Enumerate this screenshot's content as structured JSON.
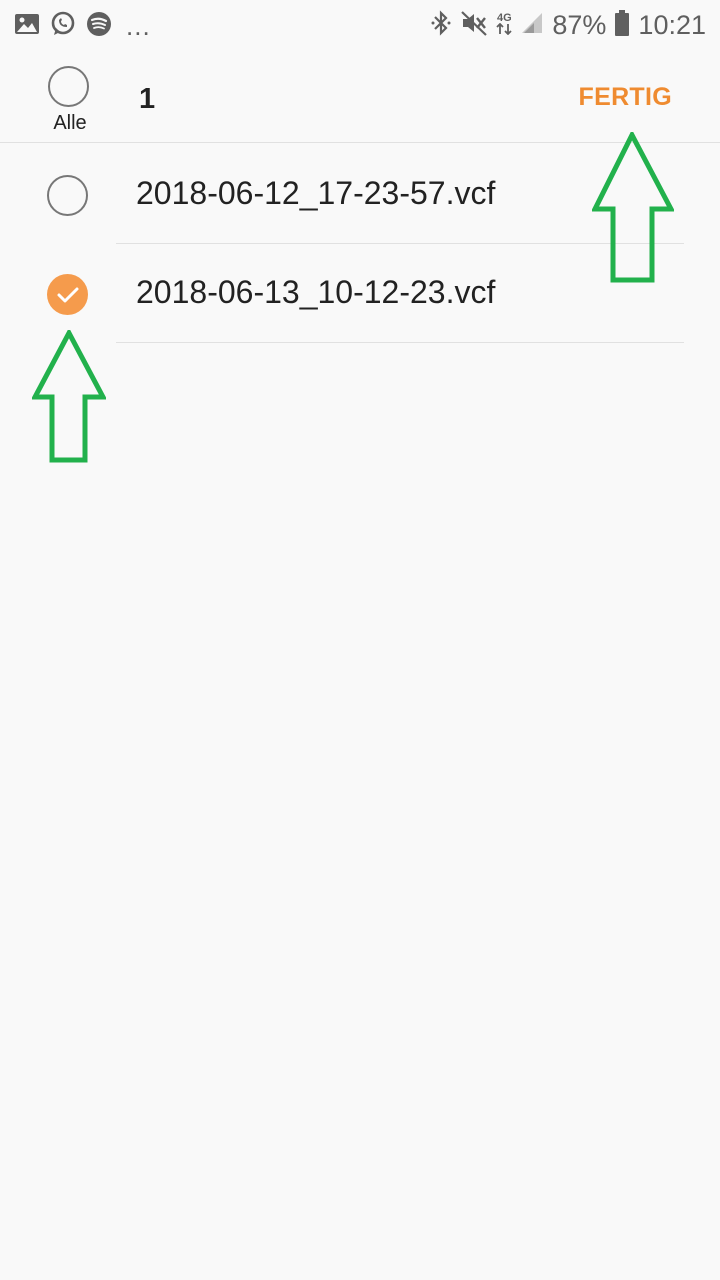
{
  "status_bar": {
    "left_icons": [
      "gallery-icon",
      "whatsapp-icon",
      "spotify-icon"
    ],
    "overflow": "...",
    "network": "4G",
    "battery_percent": "87%",
    "time": "10:21"
  },
  "header": {
    "select_all_label": "Alle",
    "selected_count": "1",
    "done_label": "FERTIG"
  },
  "files": [
    {
      "name": "2018-06-12_17-23-57.vcf",
      "checked": false
    },
    {
      "name": "2018-06-13_10-12-23.vcf",
      "checked": true
    }
  ],
  "colors": {
    "accent": "#ef8b30",
    "check_fill": "#f59b4c",
    "annotation_arrow": "#22b14c"
  },
  "annotations": [
    "green-arrow-up-icon",
    "green-arrow-up-icon"
  ]
}
